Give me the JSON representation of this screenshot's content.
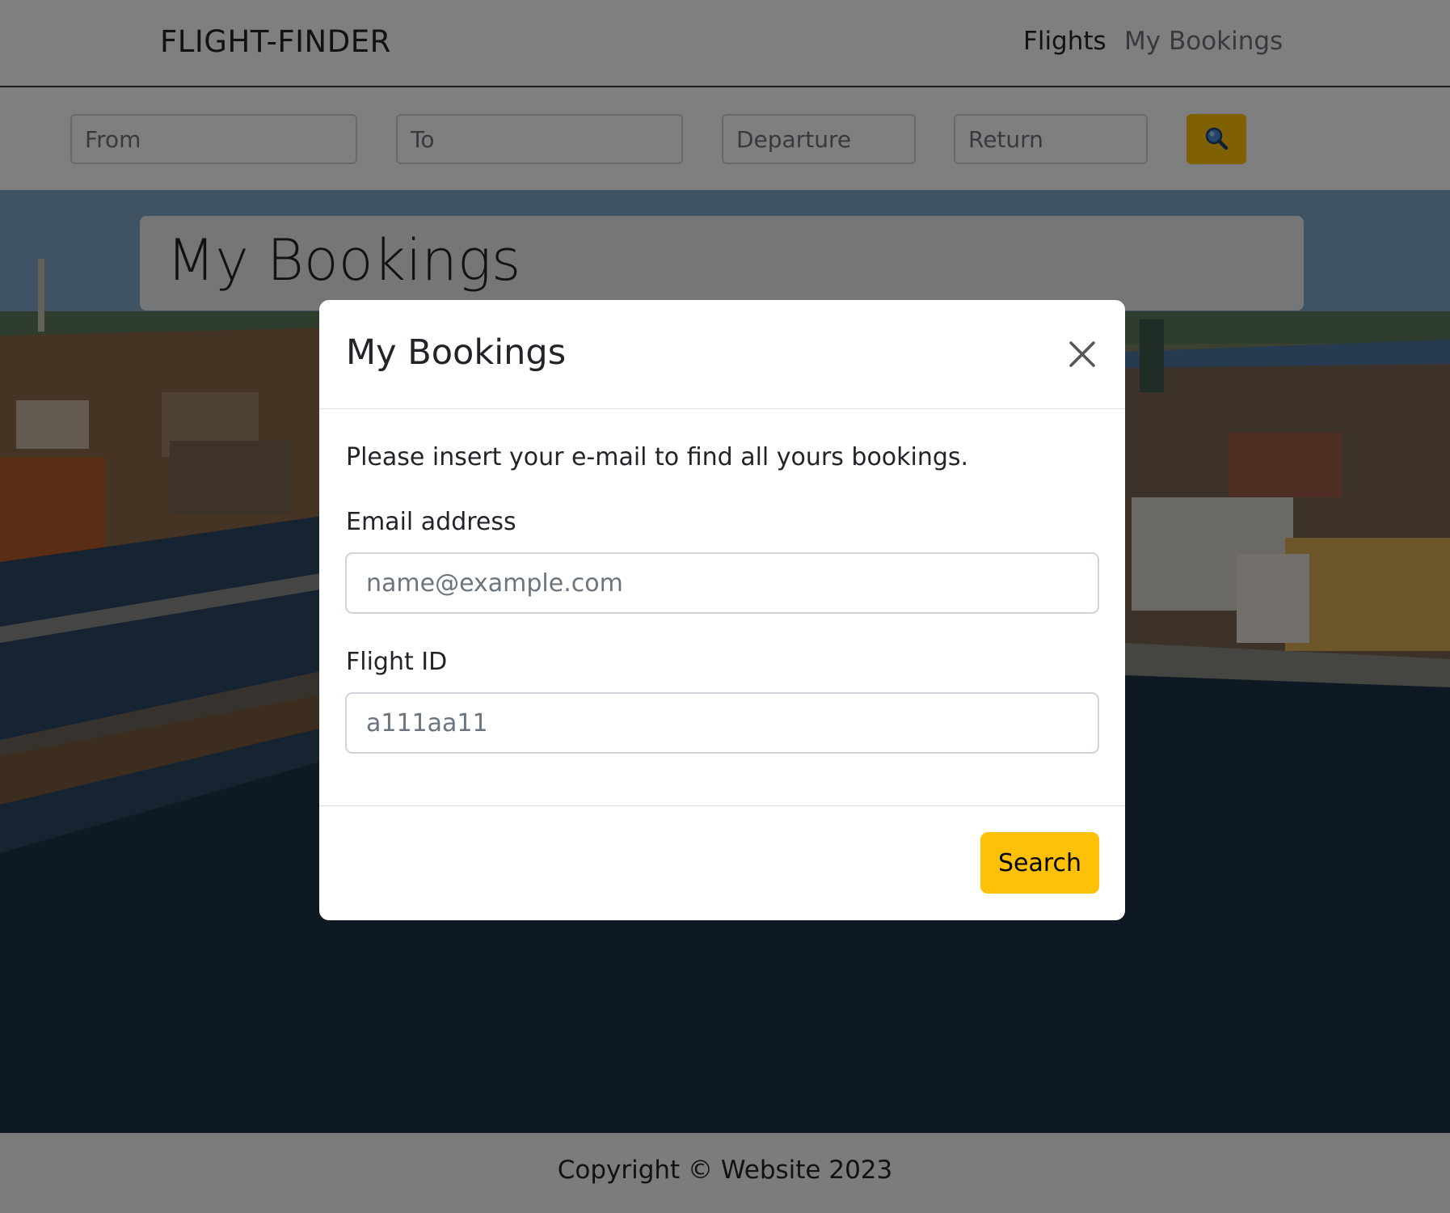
{
  "navbar": {
    "brand": "FLIGHT-FINDER",
    "links": [
      "Flights",
      "My Bookings"
    ]
  },
  "searchbar": {
    "from_placeholder": "From",
    "to_placeholder": "To",
    "departure_placeholder": "Departure",
    "return_placeholder": "Return",
    "search_icon": "search-icon"
  },
  "hero": {
    "title": "My Bookings"
  },
  "modal": {
    "title": "My Bookings",
    "close_icon": "close-icon",
    "intro": "Please insert your e-mail to find all yours bookings.",
    "email_label": "Email address",
    "email_placeholder": "name@example.com",
    "flight_label": "Flight ID",
    "flight_placeholder": "a111aa11",
    "search_label": "Search"
  },
  "footer": {
    "copyright": "Copyright © Website 2023"
  },
  "colors": {
    "accent": "#ffc107",
    "backdrop": "rgba(0,0,0,0.5)"
  }
}
